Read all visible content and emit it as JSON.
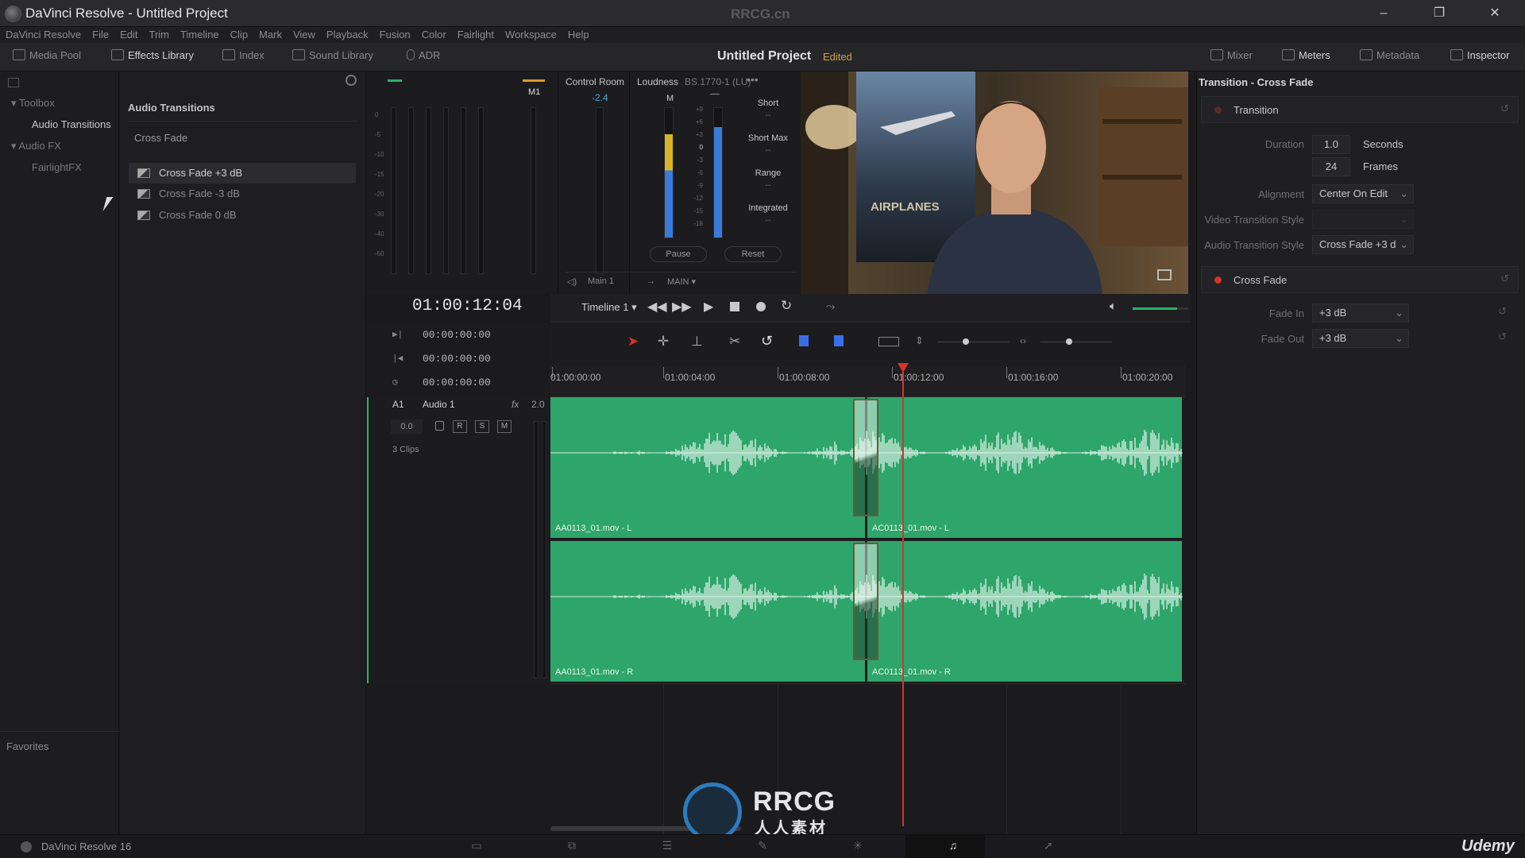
{
  "window": {
    "title": "DaVinci Resolve - Untitled Project",
    "watermark": "RRCG.cn",
    "minimize": "–",
    "restore": "❐",
    "close": "✕"
  },
  "menu": [
    "DaVinci Resolve",
    "File",
    "Edit",
    "Trim",
    "Timeline",
    "Clip",
    "Mark",
    "View",
    "Playback",
    "Fusion",
    "Color",
    "Fairlight",
    "Workspace",
    "Help"
  ],
  "toolbar": {
    "media_pool": "Media Pool",
    "effects_library": "Effects Library",
    "index": "Index",
    "sound_library": "Sound Library",
    "adr": "ADR",
    "project_title": "Untitled Project",
    "edited": "Edited",
    "mixer": "Mixer",
    "meters": "Meters",
    "metadata": "Metadata",
    "inspector": "Inspector"
  },
  "toolbox": {
    "toolbox": "Toolbox",
    "audio_transitions": "Audio Transitions",
    "audio_fx": "Audio FX",
    "fairlightfx": "FairlightFX",
    "favorites": "Favorites"
  },
  "transitions": {
    "header": "Audio Transitions",
    "group": "Cross Fade",
    "items": [
      "Cross Fade +3 dB",
      "Cross Fade -3 dB",
      "Cross Fade 0 dB"
    ]
  },
  "meters": {
    "m1_label": "M1",
    "control_room": "Control Room",
    "control_room_value": "-2.4",
    "loudness": "Loudness",
    "loudness_std": "BS.1770-1 (LU)",
    "m_label": "M",
    "short": "Short",
    "short_max": "Short Max",
    "range": "Range",
    "integrated": "Integrated",
    "dash": "--",
    "pause": "Pause",
    "reset": "Reset",
    "main1": "Main 1",
    "main": "MAIN",
    "db_scale": [
      "0",
      "-5",
      "-10",
      "-15",
      "-20",
      "-30",
      "-40",
      "-50"
    ],
    "lu_scale": [
      "+9",
      "+6",
      "+3",
      "0",
      "-3",
      "-6",
      "-9",
      "-12",
      "-15",
      "-18"
    ],
    "bus_levels": [
      0.0,
      0.0,
      0.0,
      0.0,
      0.0,
      0.0,
      0.0
    ],
    "loudness_level": 0.8,
    "right_level": 0.85
  },
  "viewer": {
    "poster_text": "AIRPLANES"
  },
  "inspector": {
    "title": "Transition - Cross Fade",
    "transition_section": "Transition",
    "duration_label": "Duration",
    "duration_value": "1.0",
    "duration_unit": "Seconds",
    "frames_value": "24",
    "frames_unit": "Frames",
    "alignment_label": "Alignment",
    "alignment_value": "Center On Edit",
    "video_style_label": "Video Transition Style",
    "audio_style_label": "Audio Transition Style",
    "audio_style_value": "Cross Fade +3 d",
    "crossfade_section": "Cross Fade",
    "fade_in_label": "Fade In",
    "fade_in_value": "+3 dB",
    "fade_out_label": "Fade Out",
    "fade_out_value": "+3 dB"
  },
  "timeline": {
    "timecode": "01:00:12:04",
    "name": "Timeline 1",
    "tc_rows": [
      "00:00:00:00",
      "00:00:00:00",
      "00:00:00:00"
    ],
    "ruler": [
      "01:00:00:00",
      "01:00:04:00",
      "01:00:08:00",
      "01:00:12:00",
      "01:00:16:00",
      "01:00:20:00"
    ],
    "track_id": "A1",
    "track_name": "Audio 1",
    "track_fx": "fx",
    "track_format": "2.0",
    "track_level": "0.0",
    "r_btn": "R",
    "s_btn": "S",
    "m_btn": "M",
    "clip_count": "3 Clips",
    "clips": {
      "a_l": "AA0113_01.mov - L",
      "b_l": "AC0113_01.mov - L",
      "a_r": "AA0113_01.mov - R",
      "b_r": "AC0113_01.mov - R"
    },
    "volume_level": 0.8
  },
  "footer": {
    "app": "DaVinci Resolve 16",
    "brand": "Udemy",
    "watermark": "RRCG",
    "watermark_sub": "人人素材"
  },
  "colors": {
    "clip_green": "#2ea56b",
    "playhead_red": "#d6332b",
    "edited_gold": "#c9a44a",
    "track_accent": "#2fb06d"
  }
}
